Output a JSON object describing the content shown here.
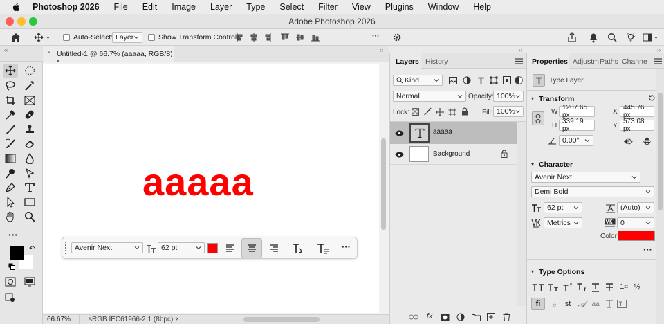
{
  "menubar": {
    "app_name": "Photoshop 2026",
    "items": [
      "File",
      "Edit",
      "Image",
      "Layer",
      "Type",
      "Select",
      "Filter",
      "View",
      "Plugins",
      "Window",
      "Help"
    ]
  },
  "window": {
    "title": "Adobe Photoshop 2026"
  },
  "options_bar": {
    "auto_select_label": "Auto-Select:",
    "auto_select_value": "Layer",
    "show_transform_label": "Show Transform Controls"
  },
  "document": {
    "tab_title": "Untitled-1 @ 66.7% (aaaaa, RGB/8) *",
    "canvas_text": "aaaaa",
    "canvas_text_color": "#ff0000",
    "zoom": "66.67%",
    "profile": "sRGB IEC61966-2.1 (8bpc)"
  },
  "contextual_bar": {
    "font": "Avenir Next",
    "size": "62 pt",
    "color": "#ff0000"
  },
  "layers_panel": {
    "tabs": [
      "Layers",
      "History"
    ],
    "filter": "Kind",
    "blend_mode": "Normal",
    "opacity_label": "Opacity:",
    "opacity_value": "100%",
    "lock_label": "Lock:",
    "fill_label": "Fill:",
    "fill_value": "100%",
    "layers": [
      {
        "name": "aaaaa",
        "type": "text",
        "selected": true
      },
      {
        "name": "Background",
        "type": "background",
        "selected": false
      }
    ]
  },
  "properties_panel": {
    "tabs": [
      "Properties",
      "Adjustm",
      "Paths",
      "Channe"
    ],
    "layer_type": "Type Layer",
    "transform": {
      "title": "Transform",
      "w_label": "W",
      "w": "1207.65 px",
      "h_label": "H",
      "h": "339.19 px",
      "x_label": "X",
      "x": "445.76 px",
      "y_label": "Y",
      "y": "573.08 px",
      "angle": "0.00°"
    },
    "character": {
      "title": "Character",
      "font": "Avenir Next",
      "style": "Demi Bold",
      "size": "62 pt",
      "leading": "(Auto)",
      "kerning": "Metrics",
      "tracking": "0",
      "color_label": "Color",
      "color": "#ff0000"
    },
    "type_options": {
      "title": "Type Options"
    }
  },
  "colors": {
    "foreground": "#000000",
    "background": "#ffffff",
    "accent": "#ff0000"
  }
}
